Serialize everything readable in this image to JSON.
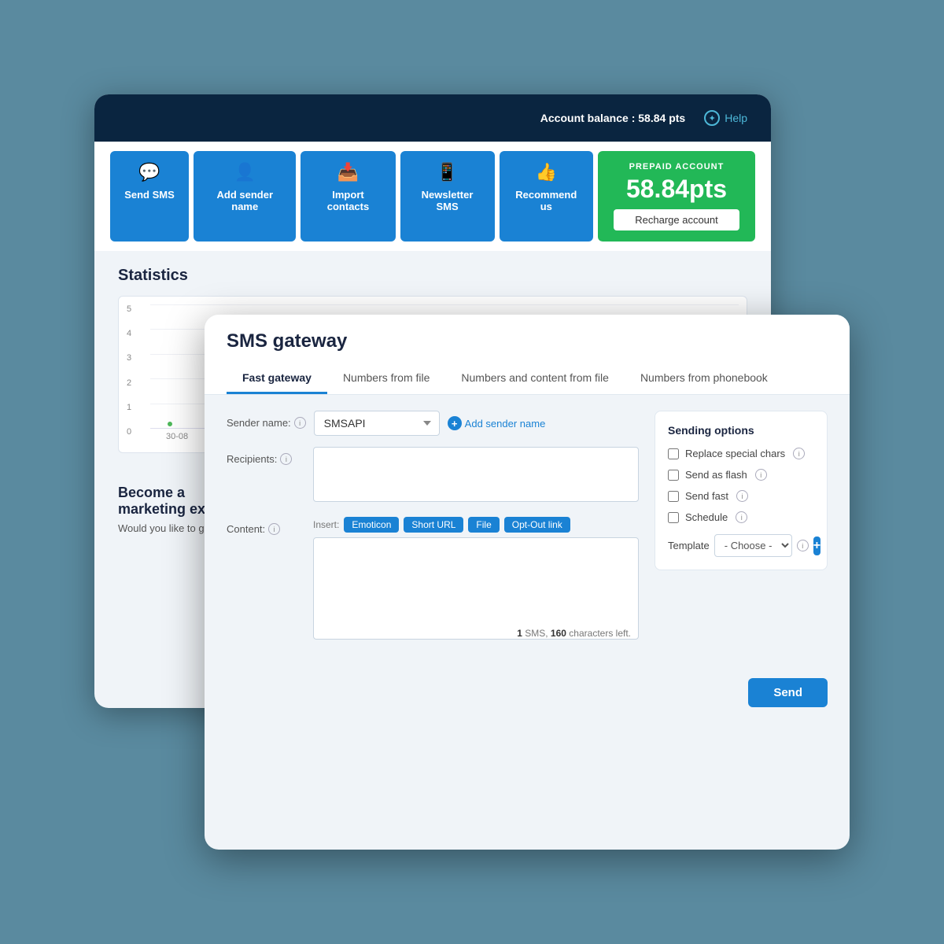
{
  "back_window": {
    "top_bar": {
      "account_balance_label": "Account balance :",
      "account_balance_value": "58.84 pts",
      "help_label": "Help"
    },
    "nav_tiles": [
      {
        "id": "send-sms",
        "icon": "💬",
        "label": "Send SMS"
      },
      {
        "id": "add-sender",
        "icon": "👤",
        "label": "Add sender name"
      },
      {
        "id": "import-contacts",
        "icon": "📥",
        "label": "Import contacts"
      },
      {
        "id": "newsletter-sms",
        "icon": "📱",
        "label": "Newsletter SMS"
      },
      {
        "id": "recommend-us",
        "icon": "👍",
        "label": "Recommend us"
      }
    ],
    "prepaid_card": {
      "label": "PREPAID ACCOUNT",
      "amount": "58.84pts",
      "recharge_btn": "Recharge account"
    },
    "statistics": {
      "title": "Statistics",
      "y_labels": [
        "5",
        "4",
        "3",
        "2",
        "1",
        "0"
      ],
      "x_label": "30-08"
    },
    "become_section": {
      "title": "Become a marketing expert",
      "sub": "Would you like to go ahead with our..."
    }
  },
  "front_window": {
    "title": "SMS gateway",
    "tabs": [
      {
        "id": "fast-gateway",
        "label": "Fast gateway",
        "active": true
      },
      {
        "id": "numbers-from-file",
        "label": "Numbers from file",
        "active": false
      },
      {
        "id": "numbers-content-file",
        "label": "Numbers and content from file",
        "active": false
      },
      {
        "id": "numbers-phonebook",
        "label": "Numbers from phonebook",
        "active": false
      }
    ],
    "form": {
      "sender_label": "Sender name:",
      "sender_value": "SMSAPI",
      "add_sender_link": "Add sender name",
      "recipients_label": "Recipients:",
      "content_label": "Content:",
      "insert_label": "Insert:",
      "insert_tags": [
        "Emoticon",
        "Short URL",
        "File",
        "Opt-Out link"
      ],
      "sms_count": "1",
      "chars_left": "160",
      "chars_left_label": "SMS,",
      "chars_left_suffix": "characters left."
    },
    "sending_options": {
      "title": "Sending options",
      "options": [
        {
          "id": "replace-special-chars",
          "label": "Replace special chars"
        },
        {
          "id": "send-as-flash",
          "label": "Send as flash"
        },
        {
          "id": "send-fast",
          "label": "Send fast"
        },
        {
          "id": "schedule",
          "label": "Schedule"
        }
      ],
      "template_label": "Template",
      "template_placeholder": "- Choose -",
      "template_options": [
        "- Choose -"
      ]
    },
    "send_btn": "Send"
  }
}
